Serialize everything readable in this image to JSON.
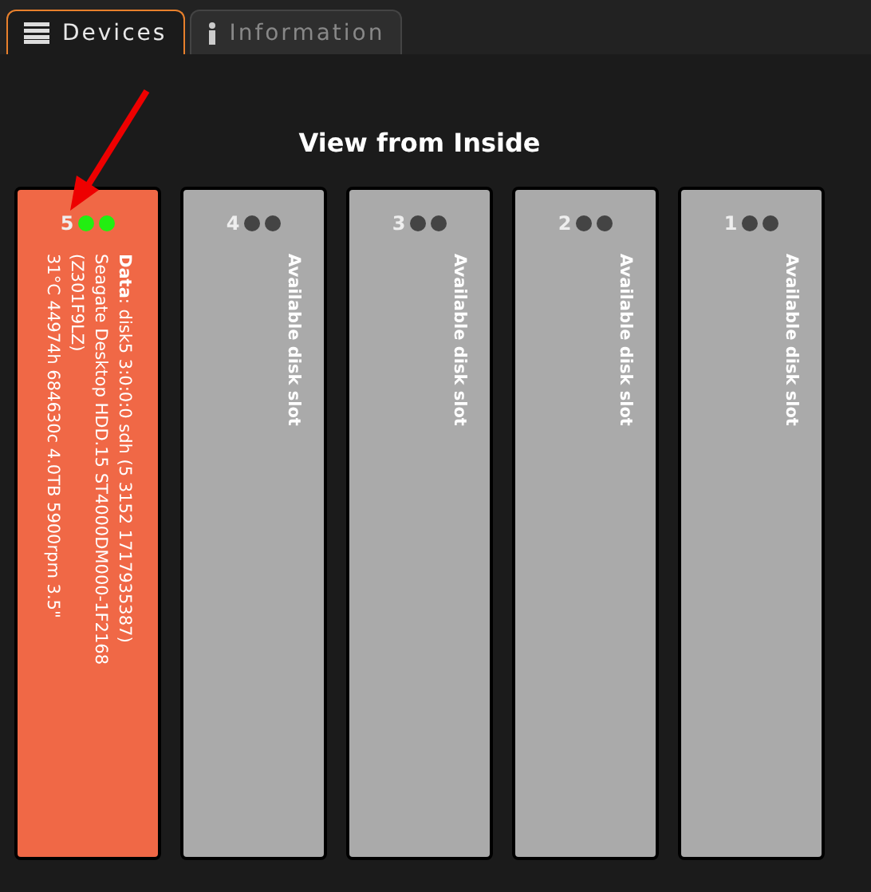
{
  "tabs": [
    {
      "label": "Devices",
      "selected": true
    },
    {
      "label": "Information",
      "selected": false
    }
  ],
  "title": "View from Inside",
  "slots": [
    {
      "number": "5",
      "kind": "disk",
      "leds": [
        {
          "on": true
        },
        {
          "on": true
        }
      ],
      "lines": [
        "**Data**: disk5 3:0:0:0 sdh (5 3152 1717935387)",
        "Seagate Desktop HDD.15 ST4000DM000-1F2168",
        "(Z301F9LZ)",
        "31°C 44974h 684630c 4.0TB 5900rpm 3.5\""
      ]
    },
    {
      "number": "4",
      "kind": "empty",
      "leds": [
        {
          "on": false
        },
        {
          "on": false
        }
      ],
      "lines": [
        "Available disk slot"
      ]
    },
    {
      "number": "3",
      "kind": "empty",
      "leds": [
        {
          "on": false
        },
        {
          "on": false
        }
      ],
      "lines": [
        "Available disk slot"
      ]
    },
    {
      "number": "2",
      "kind": "empty",
      "leds": [
        {
          "on": false
        },
        {
          "on": false
        }
      ],
      "lines": [
        "Available disk slot"
      ]
    },
    {
      "number": "1",
      "kind": "empty",
      "leds": [
        {
          "on": false
        },
        {
          "on": false
        }
      ],
      "lines": [
        "Available disk slot"
      ]
    }
  ]
}
